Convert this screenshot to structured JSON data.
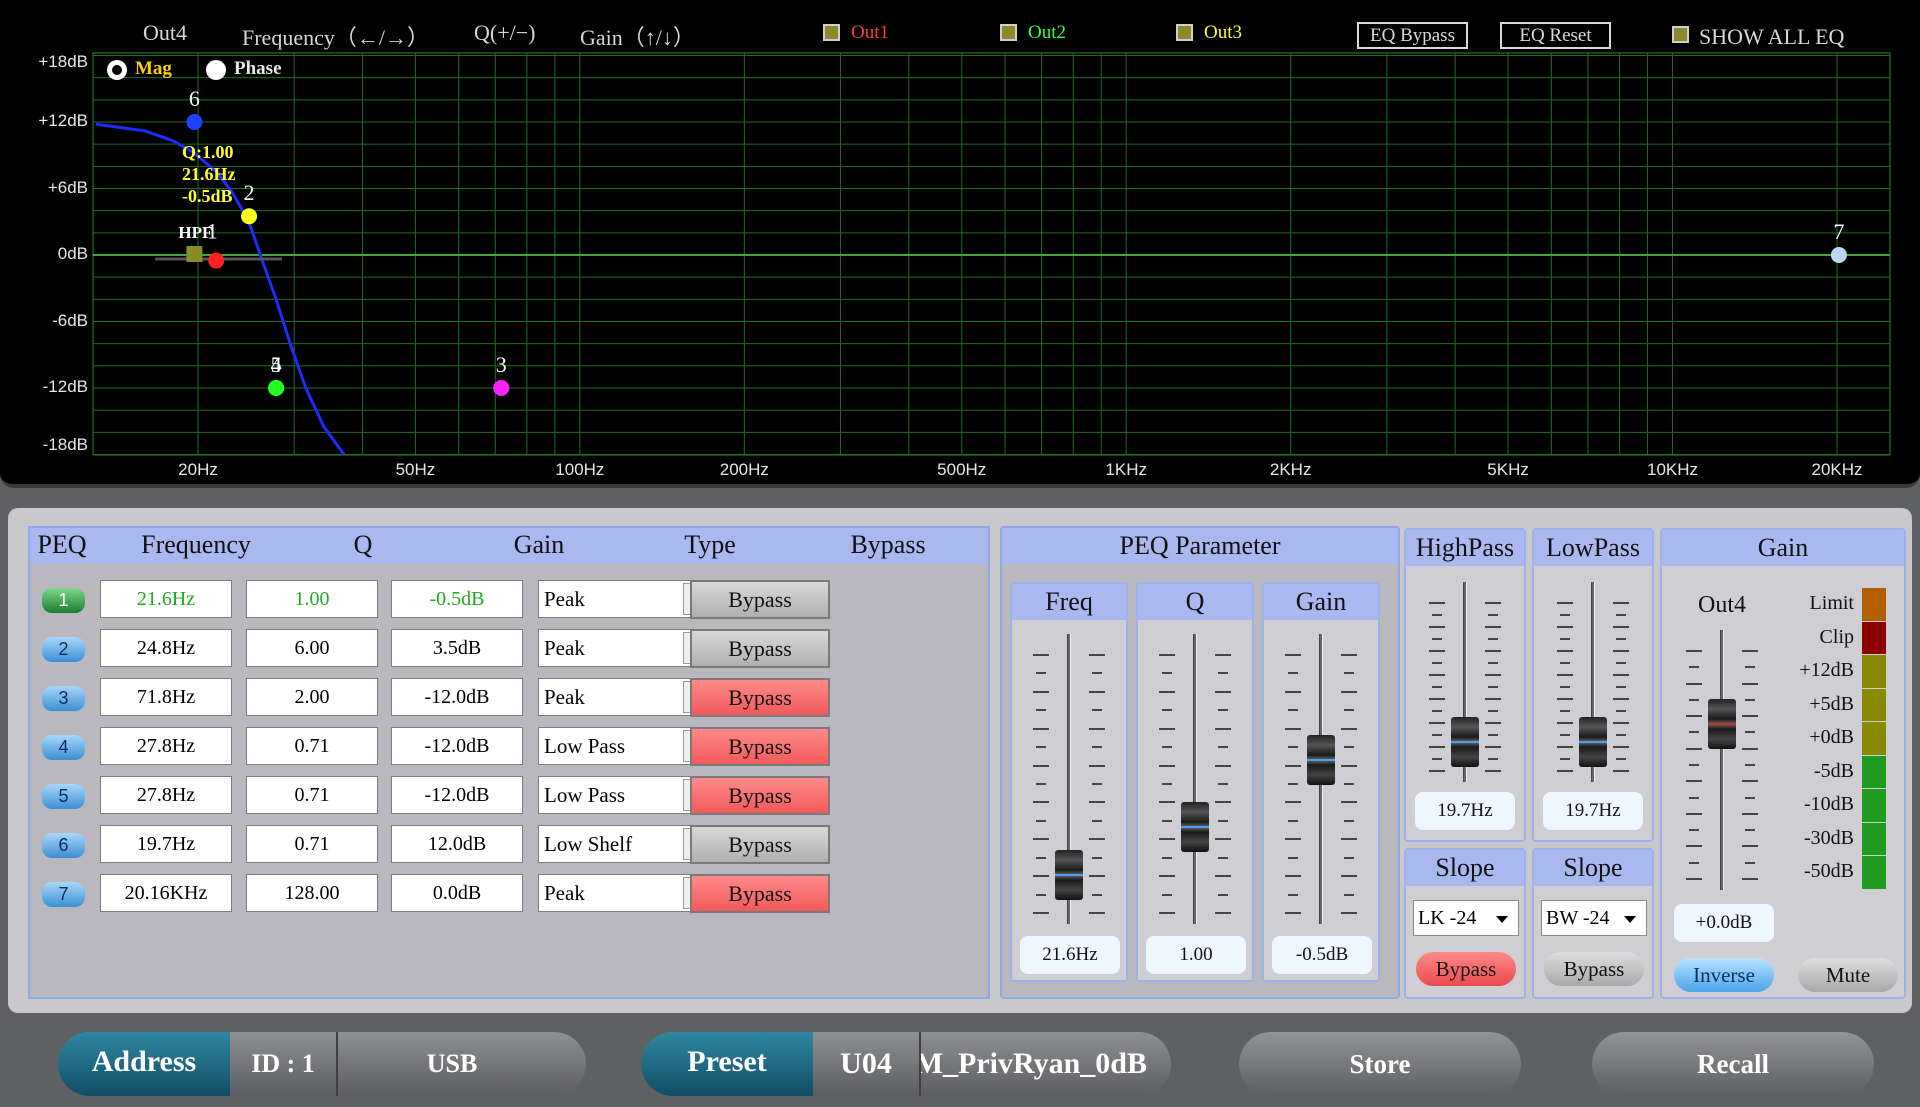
{
  "graph": {
    "channel": "Out4",
    "hint_frequency": "Frequency（←/→）",
    "hint_q": "Q(+/−)",
    "hint_gain": "Gain（↑/↓）",
    "checks": [
      {
        "label": "Out1",
        "color": "#ff3b3b"
      },
      {
        "label": "Out2",
        "color": "#3cff3c"
      },
      {
        "label": "Out3",
        "color": "#ffff3c"
      }
    ],
    "eq_bypass": "EQ Bypass",
    "eq_reset": "EQ Reset",
    "show_all": "SHOW ALL EQ",
    "mode_mag": "Mag",
    "mode_phase": "Phase",
    "y_labels": [
      "+18dB",
      "+12dB",
      "+6dB",
      "0dB",
      "-6dB",
      "-12dB",
      "-18dB"
    ],
    "x_labels": [
      "20Hz",
      "50Hz",
      "100Hz",
      "200Hz",
      "500Hz",
      "1KHz",
      "2KHz",
      "5KHz",
      "10KHz",
      "20KHz"
    ],
    "tooltip": [
      "Q:1.00",
      "21.6Hz",
      "-0.5dB"
    ],
    "hpf_label": "HPF",
    "points": [
      {
        "label": "1",
        "freq": 21.6,
        "gain": -0.5,
        "color": "#ff2020"
      },
      {
        "label": "2",
        "freq": 24.8,
        "gain": 3.5,
        "color": "#ffff20"
      },
      {
        "label": "3",
        "freq": 71.8,
        "gain": -12,
        "color": "#ff20ff"
      },
      {
        "label": "4",
        "freq": 27.8,
        "gain": -12,
        "color": "#20ff20"
      },
      {
        "label": "5",
        "freq": 27.8,
        "gain": -12,
        "color": "#20ff20"
      },
      {
        "label": "6",
        "freq": 19.7,
        "gain": 12,
        "color": "#2040ff"
      },
      {
        "label": "7",
        "freq": 20160,
        "gain": 0,
        "color": "#bcd6f5"
      }
    ]
  },
  "peq": {
    "headers": {
      "peq": "PEQ",
      "frequency": "Frequency",
      "q": "Q",
      "gain": "Gain",
      "type": "Type",
      "bypass": "Bypass"
    },
    "bands": [
      {
        "num": "1",
        "freq": "21.6Hz",
        "q": "1.00",
        "gain": "-0.5dB",
        "type": "Peak",
        "bypass": "Bypass",
        "bypass_on": false
      },
      {
        "num": "2",
        "freq": "24.8Hz",
        "q": "6.00",
        "gain": "3.5dB",
        "type": "Peak",
        "bypass": "Bypass",
        "bypass_on": false
      },
      {
        "num": "3",
        "freq": "71.8Hz",
        "q": "2.00",
        "gain": "-12.0dB",
        "type": "Peak",
        "bypass": "Bypass",
        "bypass_on": true
      },
      {
        "num": "4",
        "freq": "27.8Hz",
        "q": "0.71",
        "gain": "-12.0dB",
        "type": "Low Pass",
        "bypass": "Bypass",
        "bypass_on": true
      },
      {
        "num": "5",
        "freq": "27.8Hz",
        "q": "0.71",
        "gain": "-12.0dB",
        "type": "Low Pass",
        "bypass": "Bypass",
        "bypass_on": true
      },
      {
        "num": "6",
        "freq": "19.7Hz",
        "q": "0.71",
        "gain": "12.0dB",
        "type": "Low Shelf",
        "bypass": "Bypass",
        "bypass_on": false
      },
      {
        "num": "7",
        "freq": "20.16KHz",
        "q": "128.00",
        "gain": "0.0dB",
        "type": "Peak",
        "bypass": "Bypass",
        "bypass_on": true
      }
    ]
  },
  "peq_param": {
    "title": "PEQ Parameter",
    "freq": {
      "label": "Freq",
      "value": "21.6Hz",
      "level": 0.1
    },
    "q": {
      "label": "Q",
      "value": "1.00",
      "level": 0.3
    },
    "gain": {
      "label": "Gain",
      "value": "-0.5dB",
      "level": 0.58
    }
  },
  "highpass": {
    "title": "HighPass",
    "value": "19.7Hz",
    "level": 0.1,
    "slope_title": "Slope",
    "slope": "LK -24",
    "bypass": "Bypass"
  },
  "lowpass": {
    "title": "LowPass",
    "value": "19.7Hz",
    "level": 0.1,
    "slope_title": "Slope",
    "slope": "BW -24",
    "bypass": "Bypass"
  },
  "gain_panel": {
    "title": "Gain",
    "channel": "Out4",
    "value": "+0.0dB",
    "level": 0.67,
    "inverse": "Inverse",
    "mute": "Mute",
    "meter_labels": [
      "Limit",
      "Clip",
      "+12dB",
      "+5dB",
      "+0dB",
      "-5dB",
      "-10dB",
      "-30dB",
      "-50dB"
    ],
    "meter_colors": [
      "#b25f00",
      "#8a0000",
      "#8a8a00",
      "#8a8a00",
      "#8a8a00",
      "#1e9a1e",
      "#1e9a1e",
      "#1e9a1e",
      "#1e9a1e"
    ]
  },
  "bottom": {
    "address_label": "Address",
    "address_id": "ID : 1",
    "address_conn": "USB",
    "preset_label": "Preset",
    "preset_num": "U04",
    "preset_name": "M_PrivRyan_0dB",
    "store": "Store",
    "recall": "Recall"
  }
}
